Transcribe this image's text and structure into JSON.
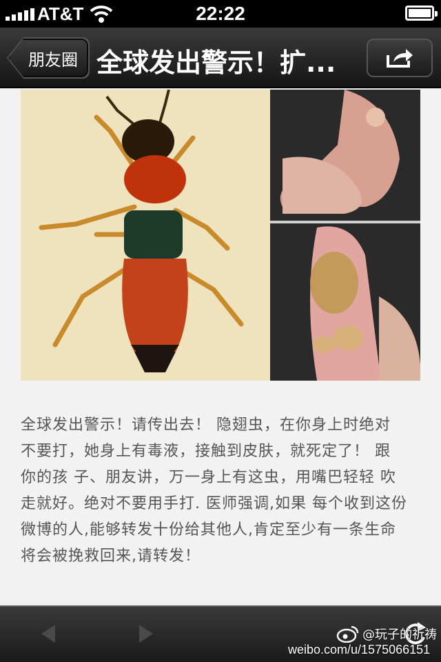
{
  "status_bar": {
    "carrier": "AT&T",
    "time": "22:22"
  },
  "nav": {
    "back_label": "朋友圈",
    "title": "全球发出警示！扩...",
    "share_icon": "share-icon"
  },
  "photo": {
    "description_icon": "photo"
  },
  "article": {
    "lines": [
      "全球发出警示！请传出去！ 隐翅虫，在你身上时绝对",
      "不要打，她身上有毒液，接触到皮肤，就死定了！ 跟",
      "你的孩 子、朋友讲，万一身上有这虫，用嘴巴轻轻 吹",
      "走就好。绝对不要用手打. 医师强调,如果 每个收到这份",
      "微博的人,能够转发十份给其他人,肯定至少有一条生命",
      "将会被挽救回来,请转发！"
    ]
  },
  "watermark": {
    "handle": "@玩子的祈祷",
    "url": "weibo.com/u/1575066151"
  },
  "colors": {
    "bar_dark": "#1a1a1a",
    "text": "#555555",
    "background": "#f2f2f2"
  }
}
